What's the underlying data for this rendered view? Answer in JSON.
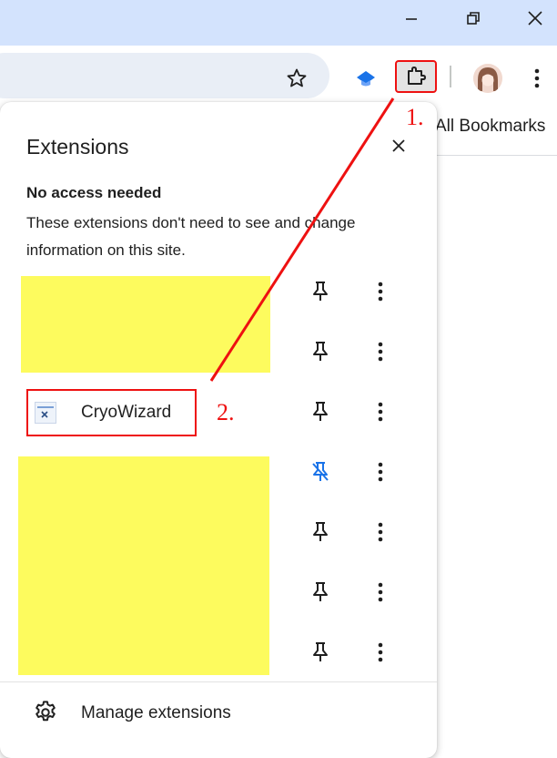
{
  "browser": {
    "bookmarks_bar": {
      "all_bookmarks": "All Bookmarks"
    }
  },
  "panel": {
    "title": "Extensions",
    "section_heading": "No access needed",
    "section_description": "These extensions don't need to see and change information on this site.",
    "extensions": [
      {
        "name": "",
        "hidden": true,
        "pinned": false
      },
      {
        "name": "",
        "hidden": true,
        "pinned": false
      },
      {
        "name": "CryoWizard",
        "hidden": false,
        "pinned": false,
        "icon": "cryowizard-logo"
      },
      {
        "name": "",
        "hidden": true,
        "pinned": true
      },
      {
        "name": "",
        "hidden": true,
        "pinned": false
      },
      {
        "name": "",
        "hidden": true,
        "pinned": false
      },
      {
        "name": "",
        "hidden": true,
        "pinned": false
      }
    ],
    "footer": {
      "manage_label": "Manage extensions"
    }
  },
  "annotations": {
    "step1": "1.",
    "step2": "2."
  },
  "colors": {
    "titlebar": "#d3e3fd",
    "accent_pinned": "#1a73e8",
    "annotation": "#ee1111",
    "redaction": "#fdfb5e"
  }
}
